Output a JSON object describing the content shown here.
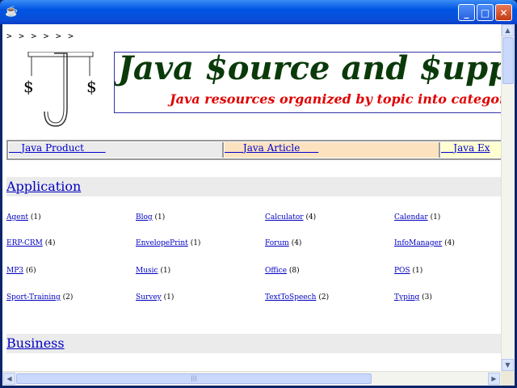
{
  "window": {
    "title": "",
    "buttons": {
      "minimize": "_",
      "maximize": "□",
      "close": "✕"
    }
  },
  "page": {
    "breadcrumb": "> > > > > >",
    "logo": {
      "letter": "J",
      "symbol_left": "$",
      "symbol_right": "$"
    },
    "banner": {
      "title": "Java $ource and $upport",
      "subtitle": "Java resources organized by topic into categories"
    },
    "tabs": [
      {
        "label": "Java Product",
        "pad_before": "    ",
        "pad_after": "       "
      },
      {
        "label": "Java Article",
        "pad_before": "      ",
        "pad_after": "      "
      },
      {
        "label": "Java Ex",
        "pad_before": "    ",
        "pad_after": ""
      }
    ],
    "sections": [
      {
        "title": "Application",
        "categories": [
          {
            "name": "Agent",
            "count": "(1)"
          },
          {
            "name": "Blog",
            "count": "(1)"
          },
          {
            "name": "Calculator",
            "count": "(4)"
          },
          {
            "name": "Calendar",
            "count": "(1)"
          },
          {
            "name": "ERP-CRM",
            "count": "(4)"
          },
          {
            "name": "EnvelopePrint",
            "count": "(1)"
          },
          {
            "name": "Forum",
            "count": "(4)"
          },
          {
            "name": "InfoManager",
            "count": "(4)"
          },
          {
            "name": "MP3",
            "count": "(6)"
          },
          {
            "name": "Music",
            "count": "(1)"
          },
          {
            "name": "Office",
            "count": "(8)"
          },
          {
            "name": "POS",
            "count": "(1)"
          },
          {
            "name": "Sport-Training",
            "count": "(2)"
          },
          {
            "name": "Survey",
            "count": "(1)"
          },
          {
            "name": "TextToSpeech",
            "count": "(2)"
          },
          {
            "name": "Typing",
            "count": "(3)"
          }
        ]
      },
      {
        "title": "Business",
        "categories": []
      }
    ]
  },
  "scrollbars": {
    "up": "▲",
    "down": "▼",
    "left": "◀",
    "right": "▶",
    "grip": "|||"
  },
  "colors": {
    "banner_title": "#0a3a0a",
    "banner_subtitle": "#e00000",
    "link": "#0000c0",
    "section_bg": "#ebebeb"
  }
}
